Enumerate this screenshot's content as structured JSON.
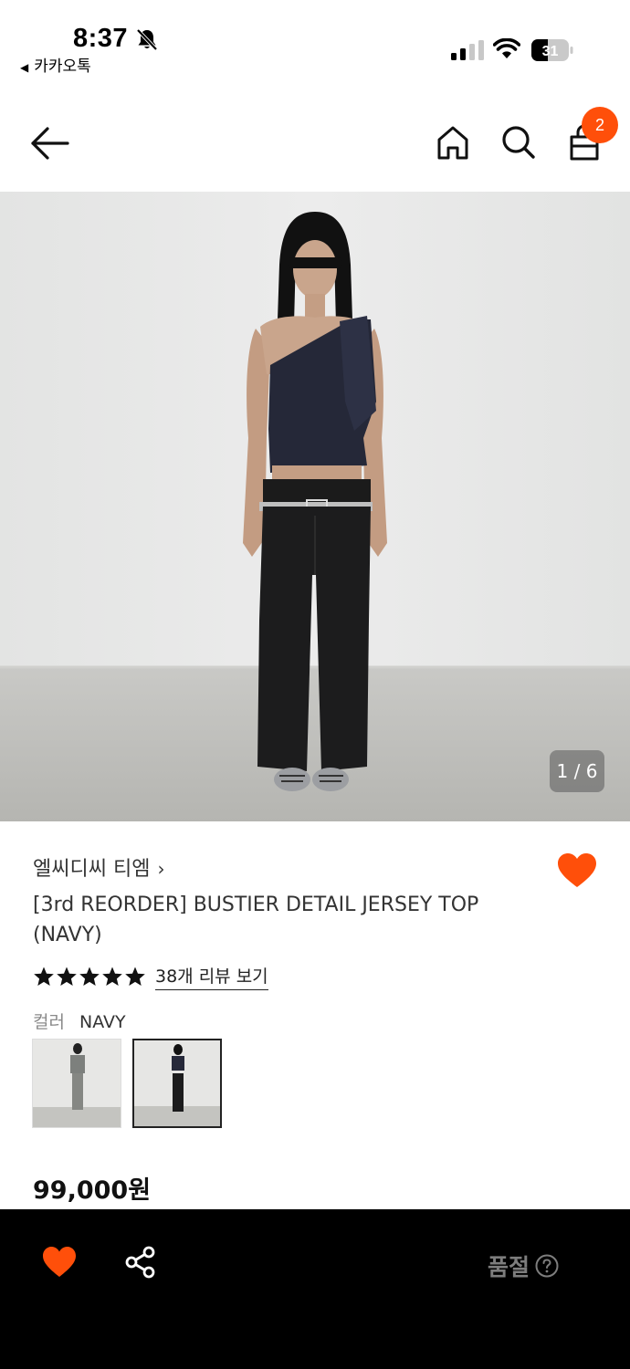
{
  "status_bar": {
    "time": "8:37",
    "back_app_label": "카카오톡",
    "battery_level": "31"
  },
  "header": {
    "cart_count": "2"
  },
  "gallery": {
    "counter": "1 / 6"
  },
  "product": {
    "brand": "엘씨디씨 티엠",
    "title": "[3rd REORDER] BUSTIER DETAIL JERSEY TOP (NAVY)",
    "rating_stars": 5,
    "review_link": "38개 리뷰 보기",
    "color_label": "컬러",
    "color_value": "NAVY",
    "price": "99,000원"
  },
  "bottom_bar": {
    "soldout_label": "품절"
  },
  "colors": {
    "accent": "#ff4f0a",
    "bottom_bar_bg": "#000000",
    "soldout_text": "#7d7d7d"
  },
  "icons": [
    "bell-slash-icon",
    "signal-icon",
    "wifi-icon",
    "battery-icon",
    "back-arrow-icon",
    "home-icon",
    "search-icon",
    "shopping-bag-icon",
    "heart-icon",
    "star-icon",
    "share-icon",
    "help-icon"
  ]
}
